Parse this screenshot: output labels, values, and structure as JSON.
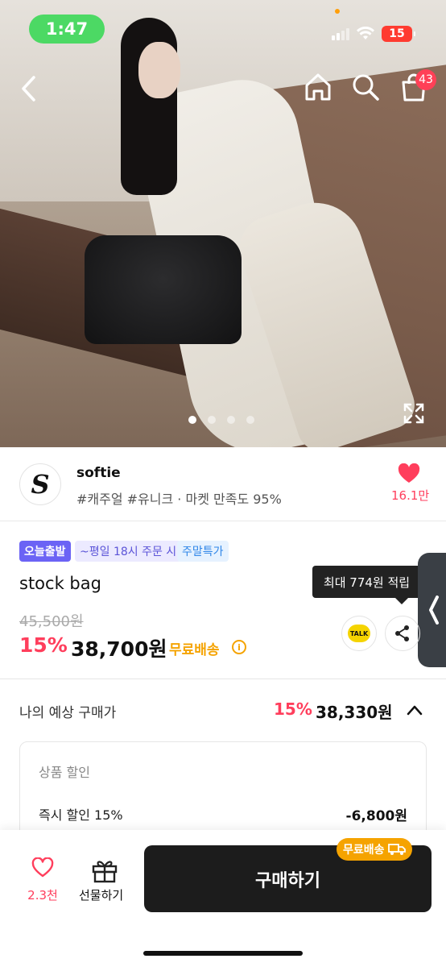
{
  "status_bar": {
    "time": "1:47",
    "battery": "15"
  },
  "nav": {
    "cart_count": "43"
  },
  "gallery": {
    "pages": 4,
    "active_page": 1
  },
  "store": {
    "logo_letter": "S",
    "name": "softie",
    "meta": "#캐주얼 #유니크 · 마켓 만족도 95%",
    "like_count": "16.1만"
  },
  "badges": [
    "오늘출발",
    "~평일 18시 주문 시",
    "주말특가"
  ],
  "product": {
    "name": "stock bag",
    "tooltip": "최대 774원 적립",
    "original_price": "45,500원",
    "discount": "15%",
    "price": "38,700원",
    "shipping": "무료배송",
    "talk_label": "TALK"
  },
  "estimate": {
    "label": "나의 예상 구매가",
    "discount": "15%",
    "price": "38,330원"
  },
  "breakdown": {
    "title": "상품 할인",
    "row_label": "즉시 할인 15%",
    "row_value": "-6,800원"
  },
  "bottom": {
    "wish_count": "2.3천",
    "gift_label": "선물하기",
    "buy_label": "구매하기",
    "free_tag": "무료배송"
  },
  "colors": {
    "accent_red": "#ff3e5c",
    "shipping_orange": "#f5a300",
    "badge_purple": "#6b63f5"
  }
}
